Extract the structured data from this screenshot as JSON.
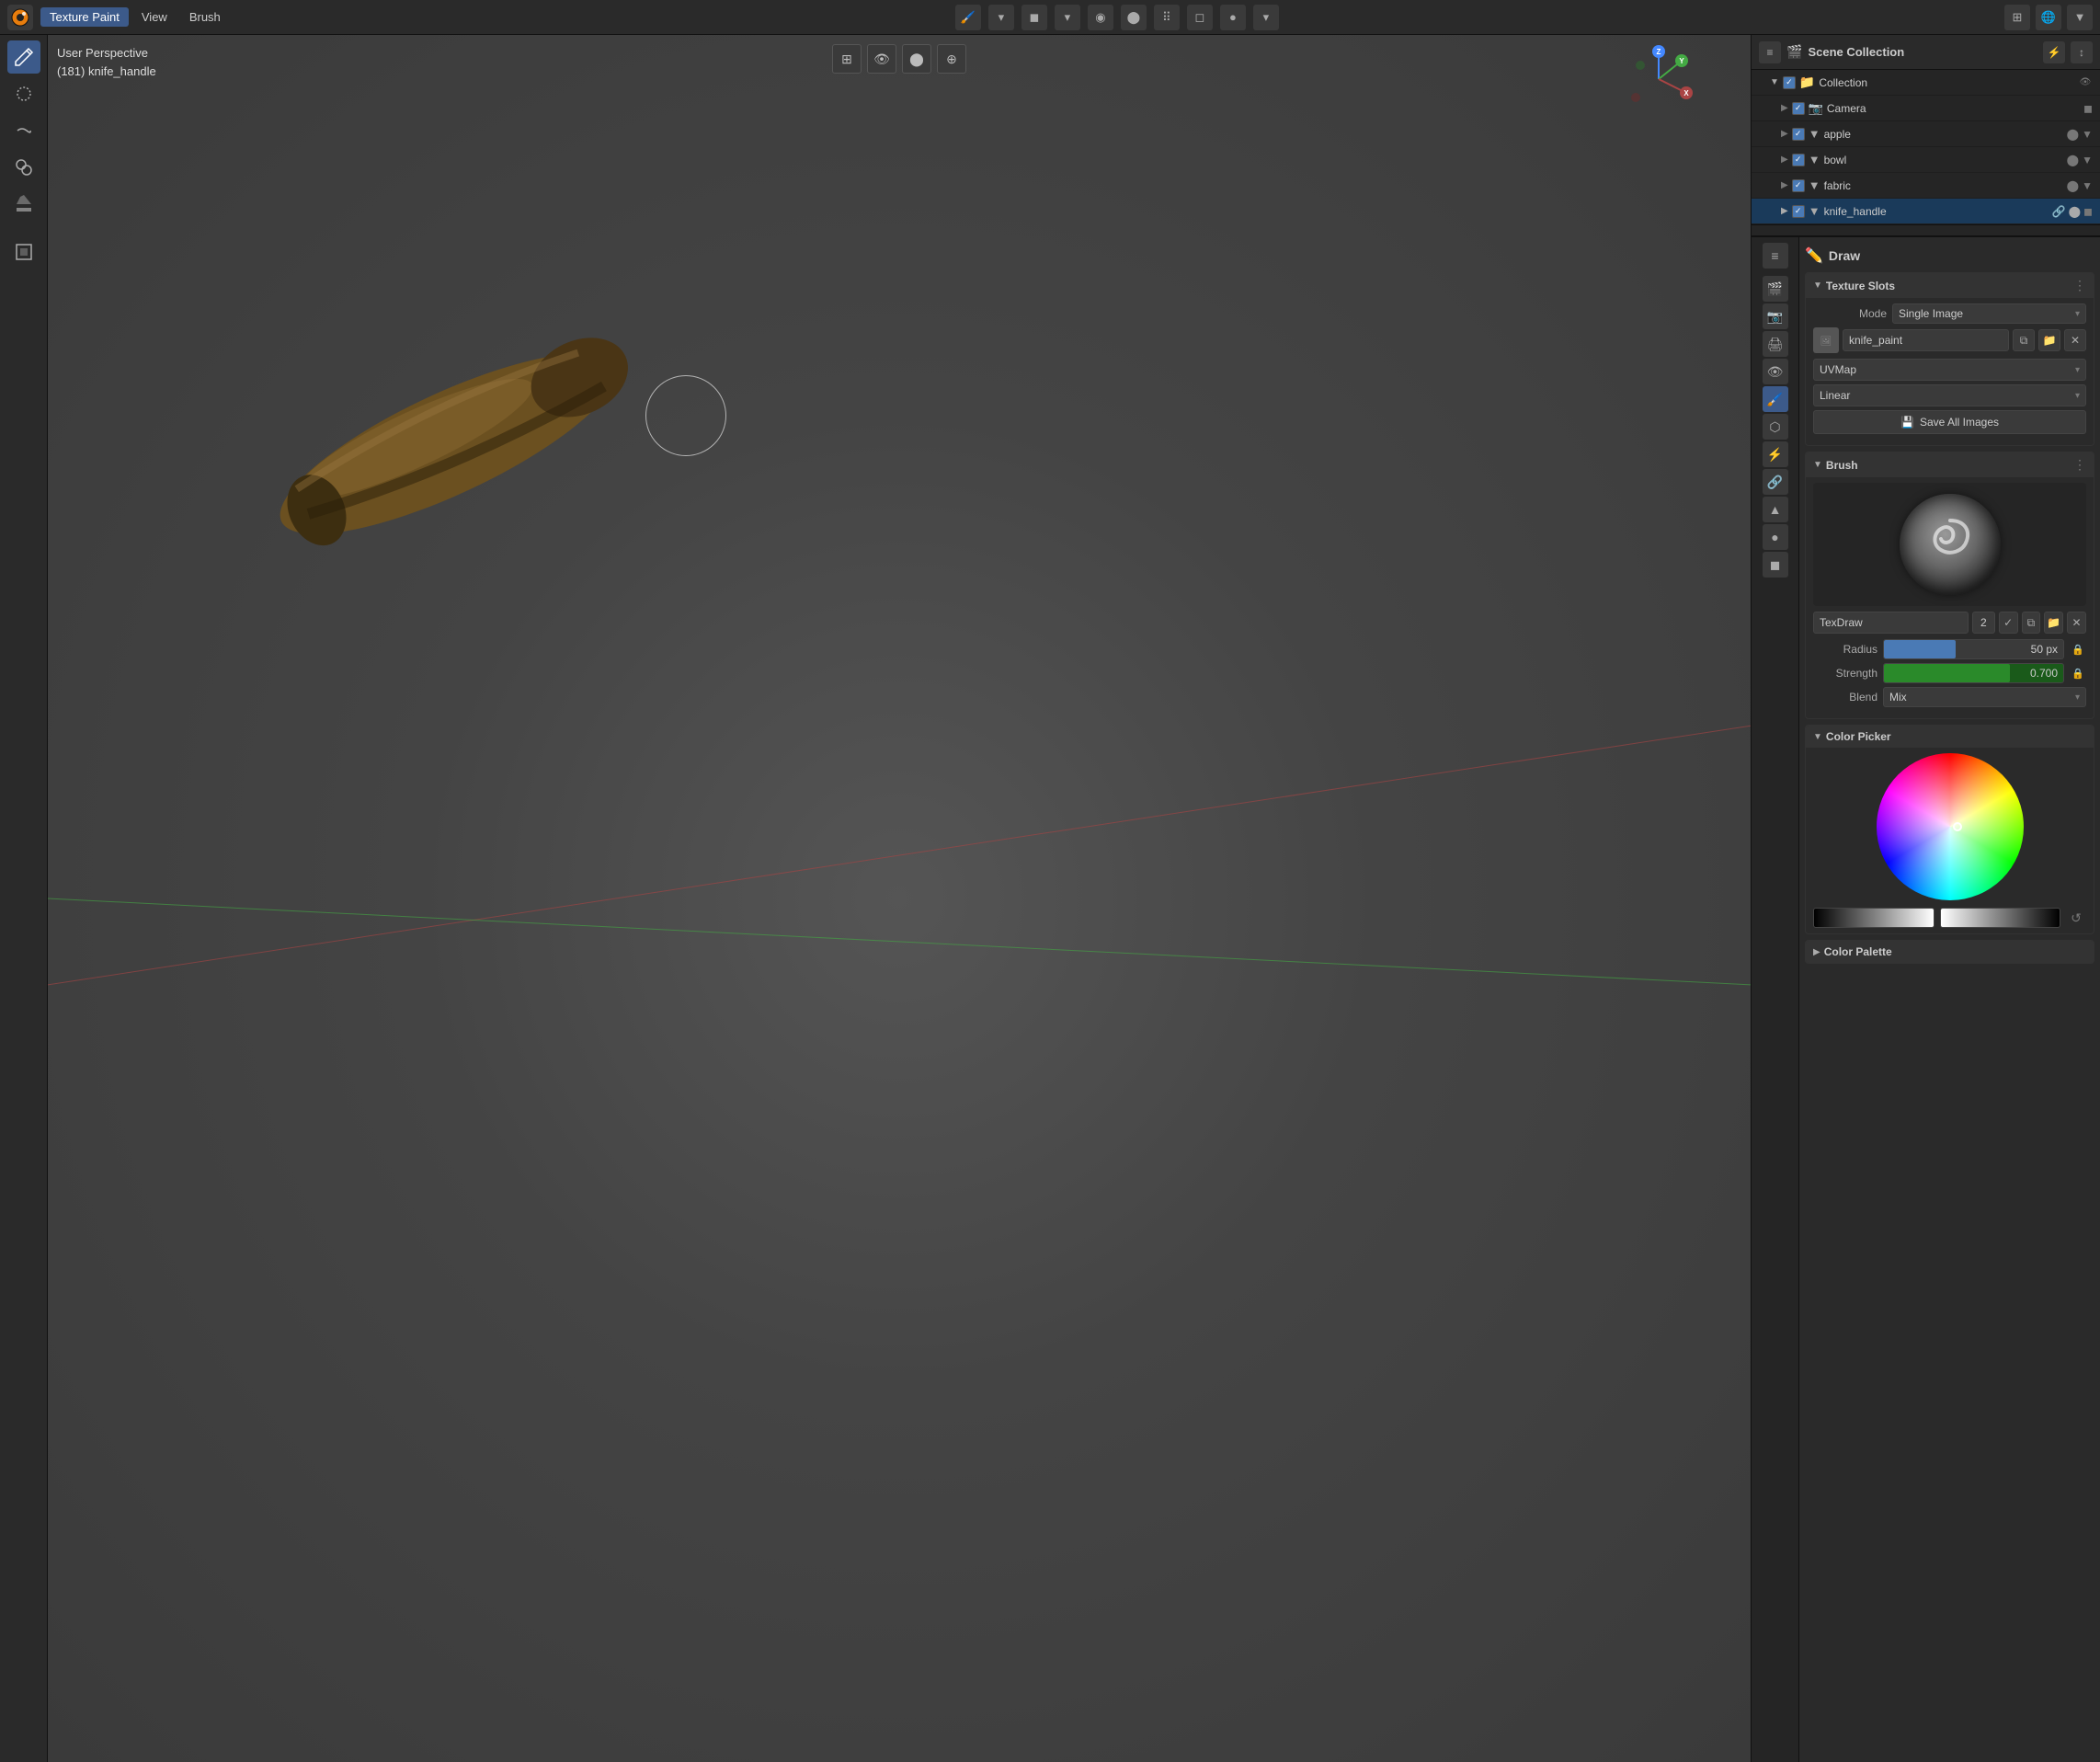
{
  "header": {
    "app_name": "Texture Paint",
    "menus": [
      "Texture Paint",
      "View",
      "Brush"
    ],
    "mode_label": "Texture Paint"
  },
  "viewport": {
    "info_line1": "User Perspective",
    "info_line2": "(181) knife_handle"
  },
  "outliner": {
    "title": "Scene Collection",
    "items": [
      {
        "name": "Collection",
        "indent": 1,
        "icon": "📁",
        "type": "collection",
        "checked": true
      },
      {
        "name": "Camera",
        "indent": 2,
        "icon": "📷",
        "type": "camera"
      },
      {
        "name": "apple",
        "indent": 2,
        "icon": "▼",
        "type": "mesh"
      },
      {
        "name": "bowl",
        "indent": 2,
        "icon": "▼",
        "type": "mesh"
      },
      {
        "name": "fabric",
        "indent": 2,
        "icon": "▼",
        "type": "mesh"
      },
      {
        "name": "knife_handle",
        "indent": 2,
        "icon": "▼",
        "type": "mesh",
        "active": true
      }
    ]
  },
  "props": {
    "draw_label": "Draw",
    "texture_slots": {
      "title": "Texture Slots",
      "mode_label": "Mode",
      "mode_value": "Single Image",
      "image_name": "knife_paint",
      "uvmap_label": "UVMap",
      "uvmap_value": "UVMap",
      "linear_value": "Linear",
      "save_btn": "Save All Images"
    },
    "brush": {
      "title": "Brush",
      "name": "TexDraw",
      "count": "2",
      "radius_label": "Radius",
      "radius_value": "50 px",
      "radius_pct": 40,
      "strength_label": "Strength",
      "strength_value": "0.700",
      "strength_pct": 70,
      "blend_label": "Blend",
      "blend_value": "Mix"
    },
    "color_picker": {
      "title": "Color Picker"
    },
    "color_palette": {
      "title": "Color Palette"
    }
  },
  "icons": {
    "draw": "✏️",
    "search": "🔍",
    "gear": "⚙️",
    "eye": "👁",
    "scene": "🎬",
    "object": "⬡",
    "modifier": "🔧",
    "particles": "⬡",
    "physics": "⬡",
    "constraints": "🔗",
    "data": "▲",
    "material": "●",
    "texture": "◼",
    "chevron_down": "▾",
    "triangle_right": "▶",
    "triangle_down": "▼",
    "refresh": "↺",
    "copy": "⧉",
    "folder": "📁",
    "close": "✕",
    "camera": "📷",
    "plus": "+",
    "minus": "-",
    "lock": "🔒",
    "filter": "⚡"
  }
}
